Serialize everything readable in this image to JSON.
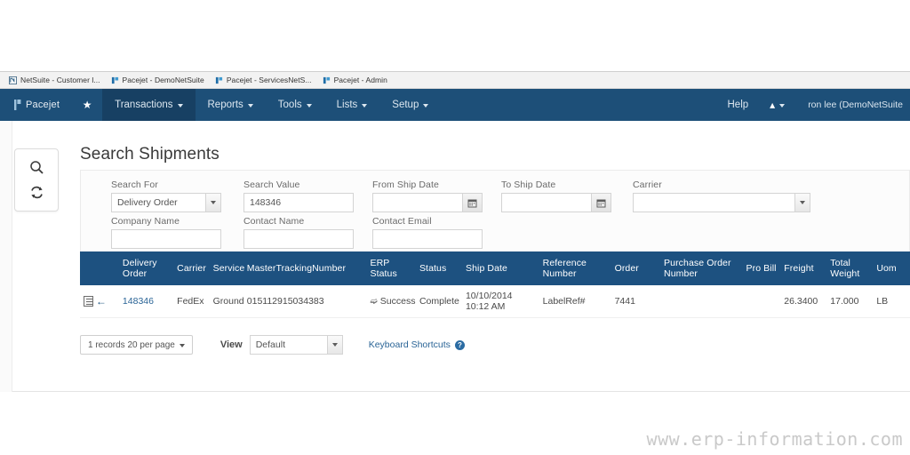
{
  "browser": {
    "tabs": [
      {
        "title": "NetSuite - Customer l...",
        "favicon": "netsuite-icon"
      },
      {
        "title": "Pacejet - DemoNetSuite",
        "favicon": "pacejet-icon"
      },
      {
        "title": "Pacejet - ServicesNetS...",
        "favicon": "pacejet-icon"
      },
      {
        "title": "Pacejet - Admin",
        "favicon": "pacejet-icon"
      }
    ]
  },
  "navbar": {
    "brand": "Pacejet",
    "star_icon": "star-icon",
    "items": [
      {
        "label": "Transactions",
        "active": true
      },
      {
        "label": "Reports",
        "active": false
      },
      {
        "label": "Tools",
        "active": false
      },
      {
        "label": "Lists",
        "active": false
      },
      {
        "label": "Setup",
        "active": false
      }
    ],
    "help_label": "Help",
    "bell_icon": "bell-icon",
    "user_label": "ron lee (DemoNetSuite",
    "background_color": "#1d4f78",
    "active_color": "#174063"
  },
  "toolpanel": {
    "search_icon": "search-icon",
    "refresh_icon": "refresh-icon"
  },
  "page": {
    "title": "Search Shipments"
  },
  "search_form": {
    "fields": [
      {
        "label": "Search For",
        "type": "select",
        "value": "Delivery Order",
        "placeholder": ""
      },
      {
        "label": "Search Value",
        "type": "text",
        "value": "148346",
        "placeholder": ""
      },
      {
        "label": "From Ship Date",
        "type": "date",
        "value": "",
        "placeholder": ""
      },
      {
        "label": "To Ship Date",
        "type": "date",
        "value": "",
        "placeholder": ""
      },
      {
        "label": "Carrier",
        "type": "select",
        "value": "",
        "placeholder": ""
      },
      {
        "label": "Company Name",
        "type": "text",
        "value": "",
        "placeholder": ""
      },
      {
        "label": "Contact Name",
        "type": "text",
        "value": "",
        "placeholder": ""
      },
      {
        "label": "Contact Email",
        "type": "text",
        "value": "",
        "placeholder": ""
      }
    ],
    "calendar_icon": "calendar-icon"
  },
  "results_table": {
    "header_color": "#1d5180",
    "columns": [
      "",
      "Delivery Order",
      "Carrier",
      "Service",
      "MasterTrackingNumber",
      "ERP Status",
      "Status",
      "Ship Date",
      "Reference Number",
      "Order",
      "Purchase Order Number",
      "Pro Bill",
      "Freight",
      "Total Weight",
      "Uom"
    ],
    "rows": [
      {
        "row_icon": "document-icon",
        "back_icon": "arrow-left-icon",
        "delivery_order": "148346",
        "carrier": "FedEx",
        "service": "Ground",
        "master_tracking_number": "015112915034383",
        "erp_status_icon": "wrench-icon",
        "erp_status": "Success",
        "status": "Complete",
        "ship_date": "10/10/2014 10:12 AM",
        "reference_number": "LabelRef#",
        "order": "7441",
        "purchase_order_number": "",
        "pro_bill": "",
        "freight": "26.3400",
        "total_weight": "17.000",
        "uom": "LB"
      }
    ]
  },
  "footer": {
    "pager_label": "1 records 20 per page",
    "view_label": "View",
    "view_value": "Default",
    "keyboard_shortcuts_label": "Keyboard Shortcuts",
    "help_icon": "question-mark-icon"
  },
  "watermark": {
    "text": "www.erp-information.com"
  }
}
